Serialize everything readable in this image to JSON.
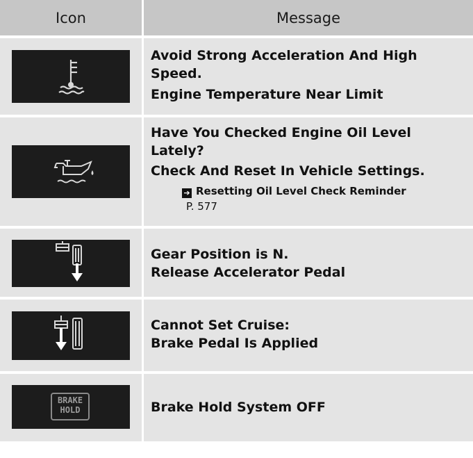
{
  "header": {
    "icon_label": "Icon",
    "message_label": "Message"
  },
  "rows": [
    {
      "icon": "coolant-temperature-icon",
      "lines": [
        "Avoid Strong Acceleration And High",
        "Speed.",
        "Engine Temperature Near Limit"
      ]
    },
    {
      "icon": "engine-oil-can-icon",
      "lines": [
        "Have You Checked Engine Oil Level",
        "Lately?",
        "Check And Reset In Vehicle Settings."
      ],
      "reference": {
        "title": "Resetting Oil Level Check Reminder",
        "page": "P. 577"
      }
    },
    {
      "icon": "release-accelerator-pedal-icon",
      "lines": [
        "Gear Position is N.",
        "Release Accelerator Pedal"
      ]
    },
    {
      "icon": "brake-pedal-applied-icon",
      "lines": [
        "Cannot Set Cruise:",
        "Brake Pedal Is Applied"
      ]
    },
    {
      "icon": "brake-hold-icon",
      "icon_text": [
        "BRAKE",
        "HOLD"
      ],
      "lines": [
        "Brake Hold System OFF"
      ]
    }
  ]
}
